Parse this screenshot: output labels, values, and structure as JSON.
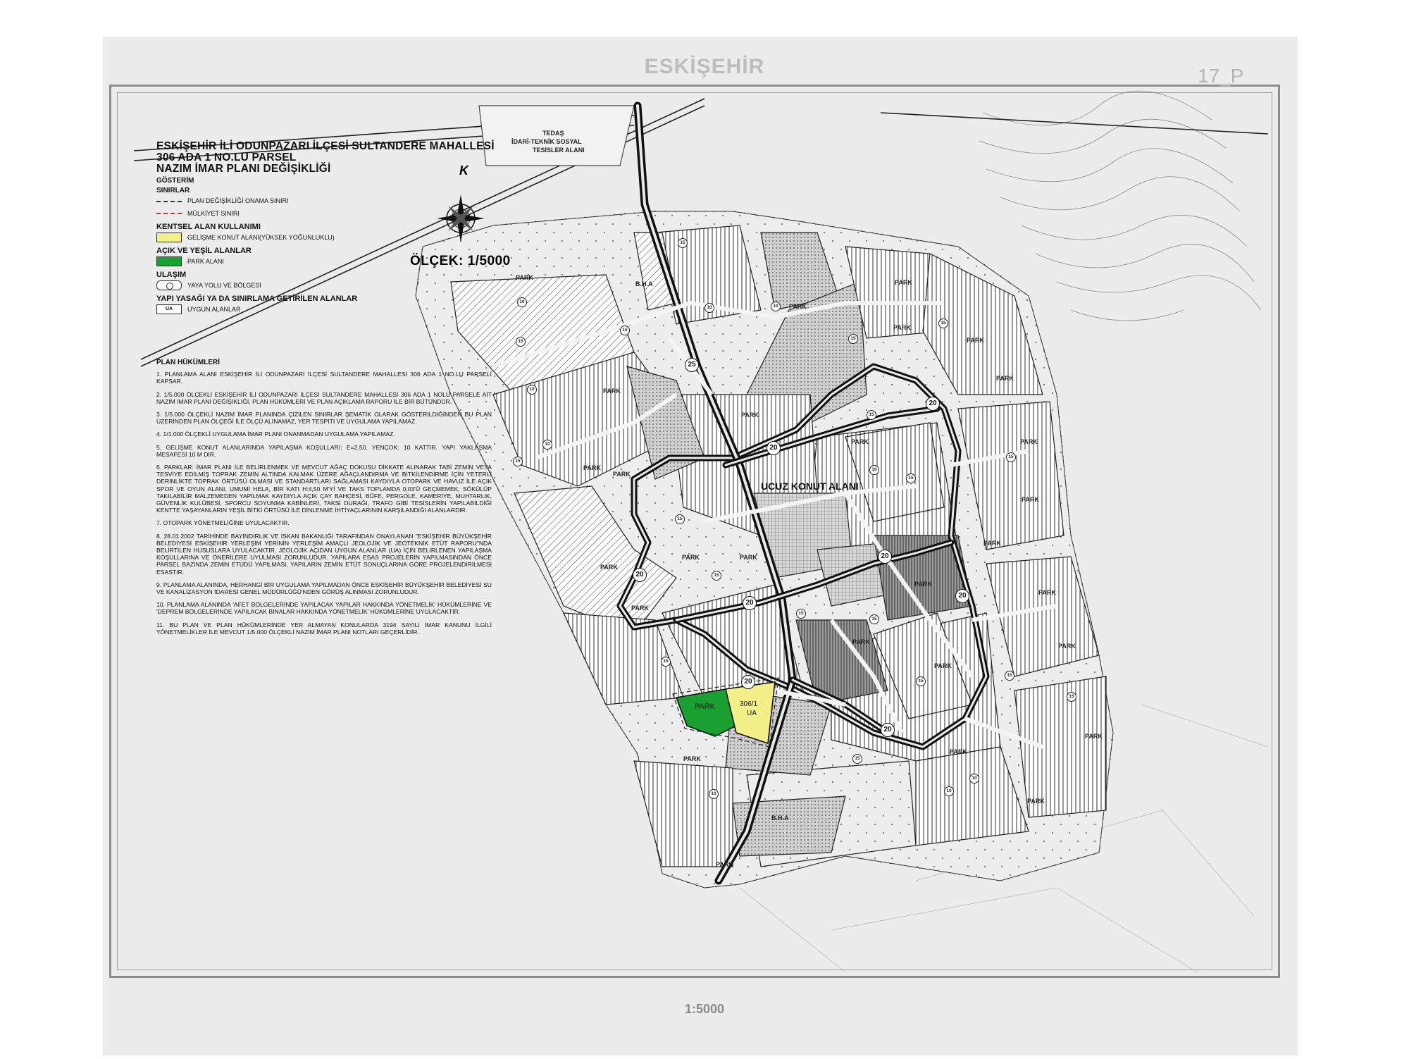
{
  "sheet": {
    "title": "ESKİŞEHİR",
    "number": "17_P",
    "bottom_scale": "1:5000"
  },
  "plan": {
    "title_lines": [
      "ESKİŞEHİR İLİ ODUNPAZARI İLÇESİ SULTANDERE MAHALLESİ",
      "306 ADA 1 NO.LU PARSEL",
      "NAZIM İMAR PLANI DEĞİŞİKLİĞİ"
    ],
    "legend_heading": "GÖSTERİM",
    "scale_label": "ÖLÇEK: 1/5000",
    "north_letter": "K"
  },
  "legend": {
    "boundaries": {
      "heading": "SINIRLAR",
      "items": [
        "PLAN DEĞİŞİKLİĞİ ONAMA SINIRI",
        "MÜLKİYET SINIRI"
      ]
    },
    "urban": {
      "heading": "KENTSEL ALAN KULLANIMI",
      "items": [
        "GELİŞME KONUT ALANI(YÜKSEK YOĞUNLUKLU)"
      ]
    },
    "green": {
      "heading": "AÇIK VE YEŞİL ALANLAR",
      "items": [
        "PARK ALANI"
      ]
    },
    "transport": {
      "heading": "ULAŞIM",
      "items": [
        "YAYA YOLU VE BÖLGESİ"
      ]
    },
    "restricted": {
      "heading": "YAPI YASAĞI YA DA SINIRLAMA GETİRİLEN ALANLAR",
      "swatch_text": "UA",
      "items": [
        "UYGUN ALANLAR"
      ]
    },
    "colors": {
      "park": "#1aa030",
      "housing": "#f3f08a",
      "property_line": "#d0302a"
    }
  },
  "provisions": {
    "title": "PLAN HÜKÜMLERİ",
    "items": [
      "1. PLANLAMA ALANI ESKİŞEHİR İLİ ODUNPAZARI İLÇESİ SULTANDERE MAHALLESİ 306 ADA 1 NO.LU PARSELİ KAPSAR.",
      "2. 1/5.000 ÖLÇEKLİ ESKİŞEHİR İLİ ODUNPAZARI İLÇESİ SULTANDERE MAHALLESİ 306 ADA 1 NOLU PARSELE AİT NAZIM İMAR PLANI DEĞİŞİKLİĞİ, PLAN HÜKÜMLERİ VE PLAN AÇIKLAMA RAPORU İLE BİR BÜTÜNDÜR.",
      "3. 1/5.000 ÖLÇEKLİ NAZIM İMAR PLANINDA ÇİZİLEN SINIRLAR ŞEMATİK OLARAK GÖSTERİLDİĞİNDEN BU PLAN ÜZERİNDEN PLAN ÖLÇEĞİ İLE ÖLÇÜ ALINAMAZ, YER TESPİTİ VE UYGULAMA YAPILAMAZ.",
      "4. 1/1.000 ÖLÇEKLİ UYGULAMA İMAR PLANI ONANMADAN UYGULAMA YAPILAMAZ.",
      "5. GELİŞME KONUT ALANLARINDA YAPILAŞMA KOŞULLARI; E=2,50, YENÇOK: 10 KATTIR. YAPI YAKLAŞMA MESAFESİ 10 M DİR.",
      "6. PARKLAR: İMAR PLANI İLE BELİRLENMEK VE MEVCUT AĞAÇ DOKUSU DİKKATE ALINARAK TABİ ZEMİN VEYA TESVİYE EDİLMİŞ TOPRAK ZEMİN ALTINDA KALMAK ÜZERE AĞAÇLANDIRMA VE BİTKİLENDİRME İÇİN YETERLİ DERİNLİKTE TOPRAK ÖRTÜSÜ OLMASI VE STANDARTLARI SAĞLAMASI KAYDIYLA OTOPARK VE HAVUZ İLE AÇIK SPOR VE OYUN ALANI, UMUMİ HELA, BİR KATI H:4,50 M'Yİ VE TAKS TOPLAMDA 0,03'Ü GEÇMEMEK, SÖKÜLÜP TAKILABİLİR MALZEMEDEN YAPILMAK KAYDIYLA AÇIK ÇAY BAHÇESİ, BÜFE, PERGOLE, KAMERİYE, MUHTARLIK, GÜVENLİK KULÜBESİ, SPORCU SOYUNMA KABİNLERİ, TAKSİ DURAĞI, TRAFO GİBİ TESİSLERİN YAPILABİLDİĞİ KENTTE YAŞAYANLARIN YEŞİL BİTKİ ÖRTÜSÜ İLE DİNLENME İHTİYAÇLARININ KARŞILANDIĞI ALANLARDIR.",
      "7. OTOPARK YÖNETMELİĞİNE UYULACAKTIR.",
      "8. 28.01.2002 TARİHİNDE BAYINDIRLIK VE İSKAN BAKANLIĞI TARAFINDAN ONAYLANAN \"ESKİŞEHİR BÜYÜKŞEHİR BELEDİYESİ ESKİŞEHİR YERLEŞİM YERİNİN YERLEŞİM AMAÇLI JEOLOJİK VE JEOTEKNİK ETÜT RAPORU\"NDA BELİRTİLEN HUSUSLARA UYULACAKTIR. JEOLOJİK AÇIDAN UYGUN ALANLAR (UA) İÇİN BELİRLENEN YAPILAŞMA KOŞULLARINA VE ÖNERİLERE UYULMASI ZORUNLUDUR. YAPILARA ESAS PROJELERİN YAPILMASINDAN ÖNCE PARSEL BAZINDA ZEMİN ETÜDÜ YAPILMASI, YAPILARIN ZEMİN ETÜT SONUÇLARINA GÖRE PROJELENDİRİLMESİ ESASTIR.",
      "9. PLANLAMA ALANINDA, HERHANGİ BİR UYGULAMA YAPILMADAN ÖNCE ESKİŞEHİR BÜYÜKŞEHİR BELEDİYESİ SU VE KANALİZASYON İDARESİ GENEL MÜDÜRLÜĞÜ'NDEN GÖRÜŞ ALINMASI ZORUNLUDUR.",
      "10. PLANLAMA ALANINDA 'AFET BÖLGELERİNDE YAPILACAK YAPILAR HAKKINDA YÖNETMELİK' HÜKÜMLERİNE VE 'DEPREM BÖLGELERİNDE YAPILACAK BİNALAR HAKKINDA YÖNETMELİK' HÜKÜMLERİNE UYULACAKTIR.",
      "11. BU PLAN VE PLAN HÜKÜMLERİNDE YER ALMAYAN KONULARDA 3194 SAYILI İMAR KANUNU İLGİLİ YÖNETMELİKLER İLE MEVCUT 1/5.000 ÖLÇEKLİ NAZIM İMAR PLANI NOTLARI GEÇERLİDİR."
    ]
  },
  "map": {
    "district_label": "UCUZ KONUT ALANI",
    "teknik_line1": "TEDAŞ",
    "teknik_line2": "İDARİ-TEKNİK SOSYAL",
    "teknik_line3": "TESİSLER ALANI",
    "bha_label": "B.H.A",
    "park_label": "PARK",
    "parcel_line1": "306/1",
    "parcel_line2": "UA",
    "road_widths": [
      "25",
      "20",
      "15",
      "10"
    ]
  }
}
